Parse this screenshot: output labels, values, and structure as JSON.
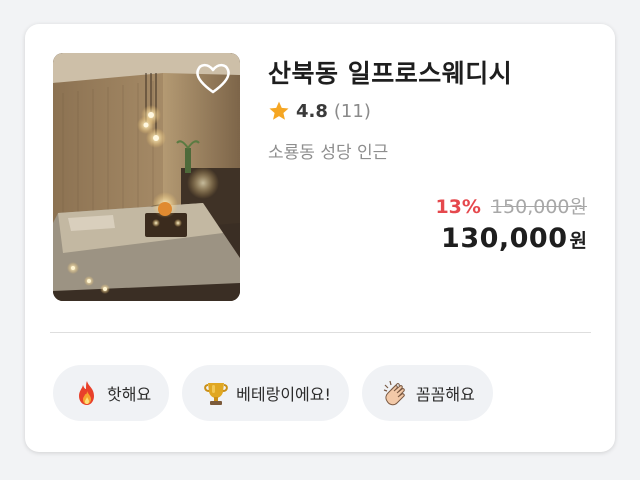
{
  "product": {
    "title": "산북동 일프로스웨디시",
    "rating": "4.8",
    "review_count": "(11)",
    "location": "소룡동 성당 인근",
    "favorited": false
  },
  "price": {
    "discount_rate": "13%",
    "original_price": "150,000원",
    "final_price": "130,000",
    "final_unit": "원"
  },
  "tags": [
    {
      "icon": "fire-icon",
      "label": "핫해요"
    },
    {
      "icon": "trophy-icon",
      "label": "베테랑이에요!"
    },
    {
      "icon": "clapping-hands-icon",
      "label": "꼼꼼해요"
    }
  ],
  "colors": {
    "discount": "#e5484d",
    "star": "#f5a623",
    "title": "#1e1e1e",
    "muted": "#8e8e8e",
    "tag_bg": "#f0f2f5"
  }
}
